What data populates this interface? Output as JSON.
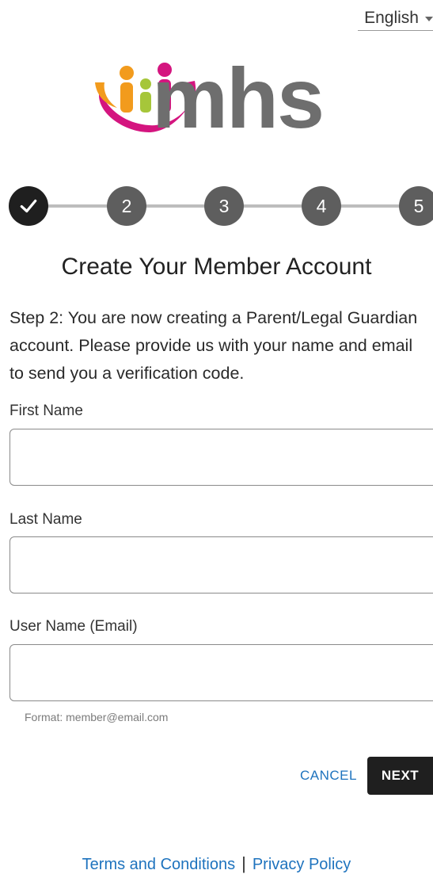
{
  "language": {
    "selected": "English",
    "icon": "globe-icon"
  },
  "brand": {
    "name": "mhs",
    "logo_colors": {
      "magenta": "#d4157f",
      "orange": "#f29b1d",
      "lime": "#a6c63a",
      "gray": "#6e6e6e"
    }
  },
  "stepper": {
    "steps": [
      "",
      "2",
      "3",
      "4",
      "5"
    ],
    "current_step": 2,
    "completed_icon": "check-icon"
  },
  "page": {
    "title": "Create Your Member Account",
    "description": "Step 2: You are now creating a Parent/Legal Guardian account. Please provide us with your name and email to send you a verification code."
  },
  "form": {
    "first_name": {
      "label": "First Name",
      "value": ""
    },
    "last_name": {
      "label": "Last Name",
      "value": ""
    },
    "email": {
      "label": "User Name (Email)",
      "value": "",
      "hint": "Format: member@email.com"
    }
  },
  "actions": {
    "cancel": "CANCEL",
    "next": "NEXT"
  },
  "footer": {
    "terms": "Terms and Conditions",
    "separator": "|",
    "privacy": "Privacy Policy"
  },
  "colors": {
    "link": "#1e73be",
    "primary_button": "#1f1f1f",
    "step_pending": "#5e5e5e",
    "step_done": "#1f1f1f"
  }
}
